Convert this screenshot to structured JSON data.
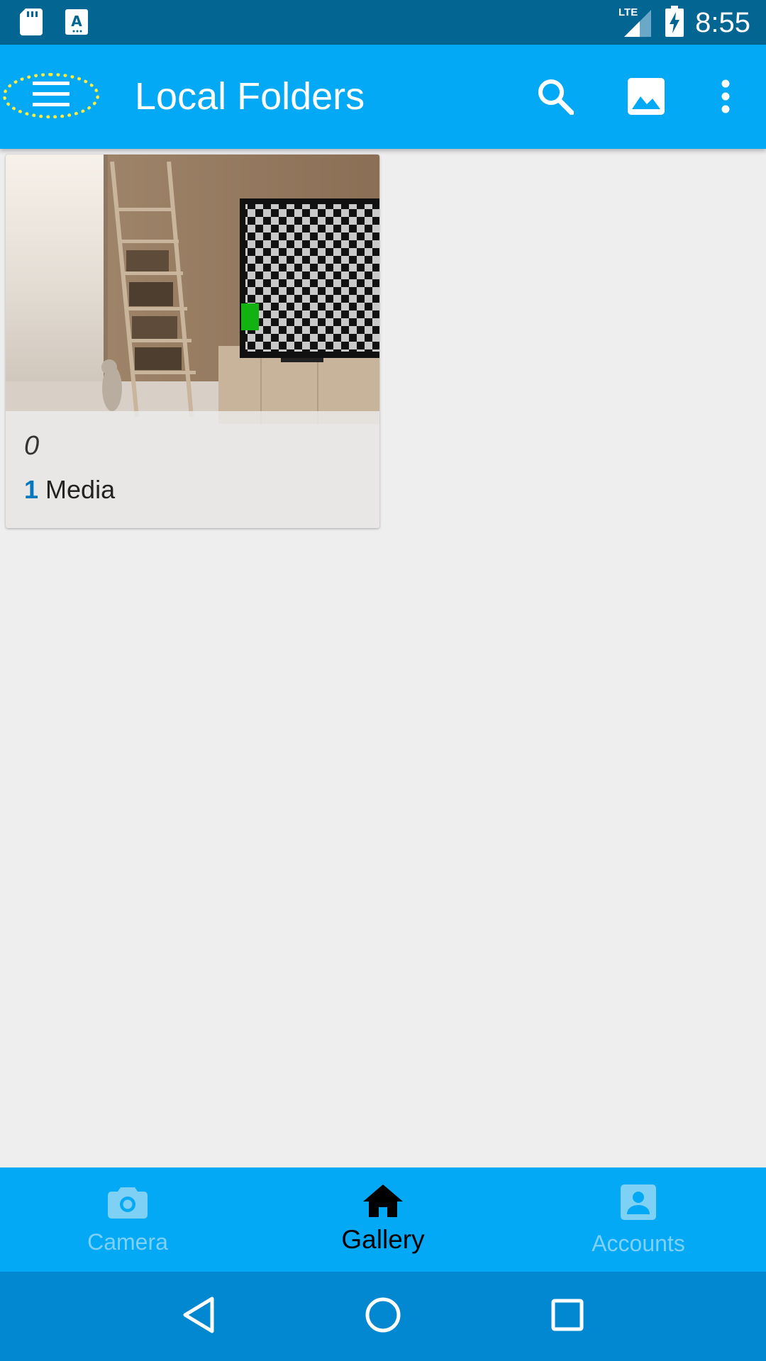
{
  "status_bar": {
    "time": "8:55",
    "network": "LTE",
    "icons": [
      "sd-card-icon",
      "text-notification-icon",
      "signal-icon",
      "battery-charging-icon"
    ]
  },
  "app_bar": {
    "title": "Local Folders",
    "actions": [
      "search-icon",
      "image-icon",
      "more-vert-icon"
    ]
  },
  "folders": [
    {
      "name": "0",
      "count": "1",
      "count_label": "Media"
    }
  ],
  "bottom_nav": {
    "items": [
      {
        "label": "Camera",
        "icon": "camera-icon",
        "active": false
      },
      {
        "label": "Gallery",
        "icon": "home-icon",
        "active": true
      },
      {
        "label": "Accounts",
        "icon": "account-icon",
        "active": false
      }
    ]
  },
  "system_nav": [
    "back-icon",
    "home-circle-icon",
    "recents-icon"
  ],
  "colors": {
    "status_bar": "#036592",
    "primary": "#03a9f4",
    "system_nav": "#0288d1",
    "background": "#eeeeee",
    "count_accent": "#0277bd",
    "focus_ring": "#ffeb3b"
  }
}
